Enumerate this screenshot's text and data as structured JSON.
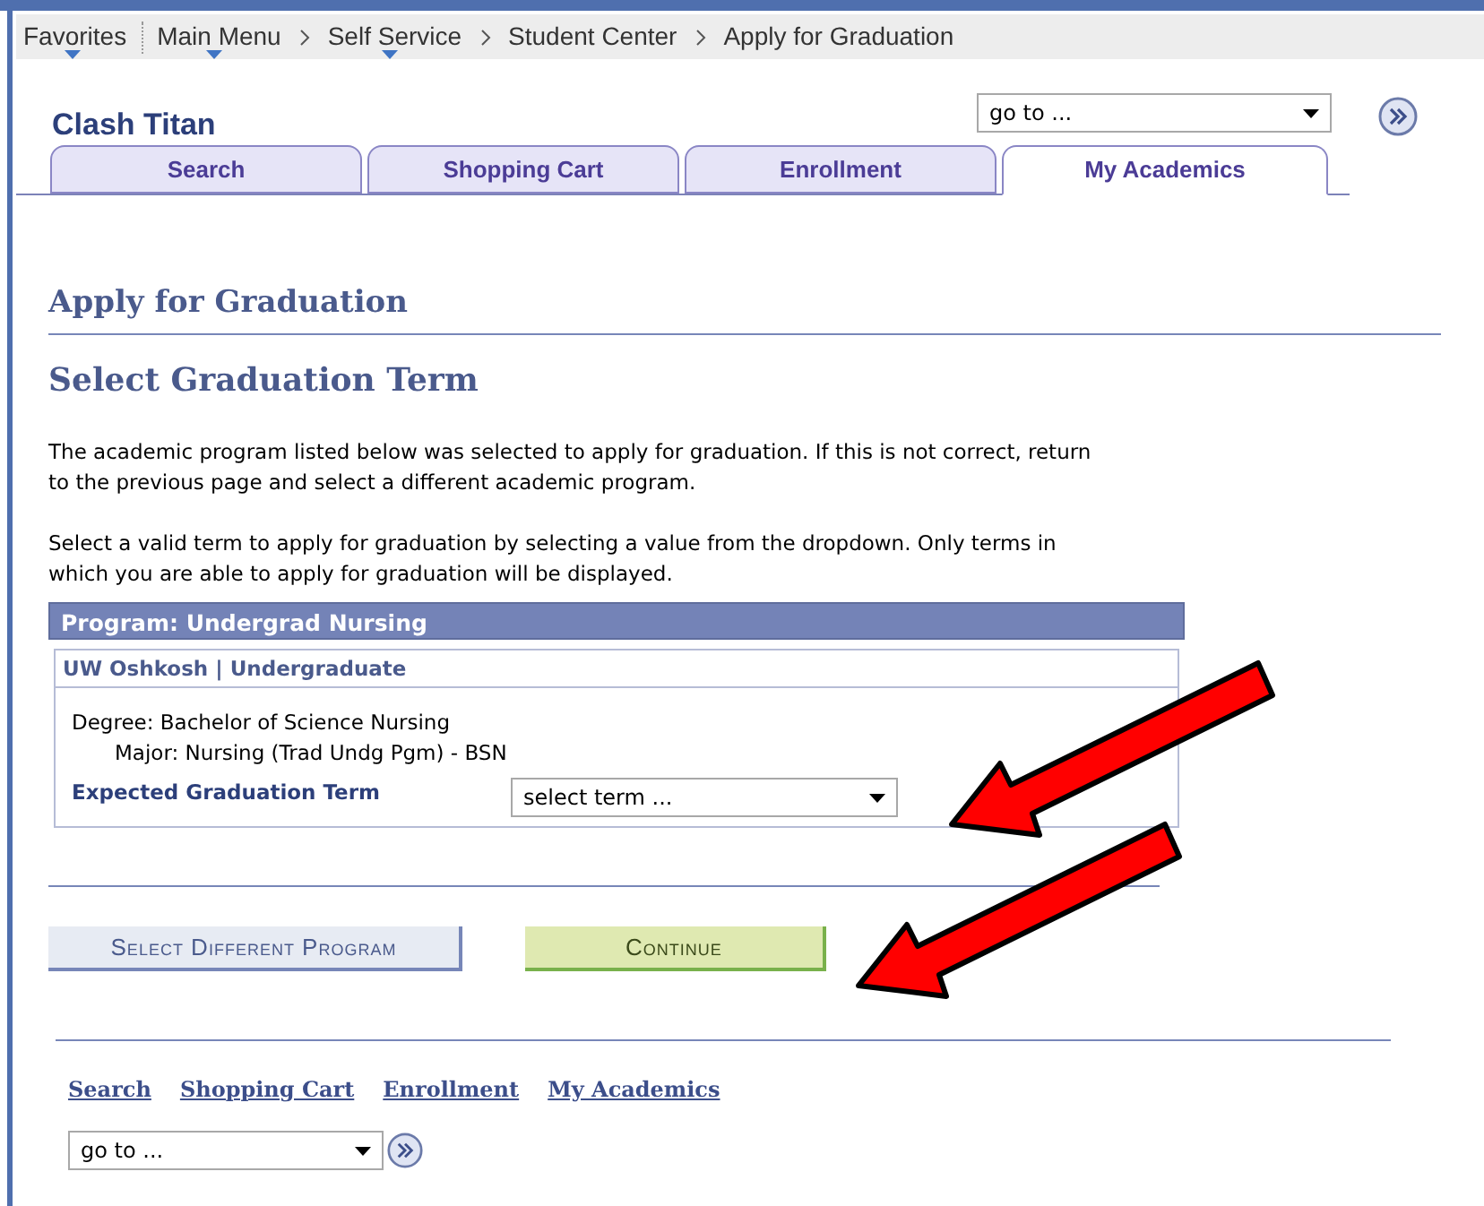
{
  "breadcrumbs": [
    {
      "label": "Favorites",
      "dropdown": true
    },
    {
      "label": "Main Menu",
      "dropdown": true
    },
    {
      "label": "Self Service",
      "dropdown": true
    },
    {
      "label": "Student Center",
      "dropdown": false
    },
    {
      "label": "Apply for Graduation",
      "dropdown": false
    }
  ],
  "student_name": "Clash Titan",
  "goto_select": {
    "value": "go to ..."
  },
  "tabs": [
    {
      "label": "Search",
      "selected": false
    },
    {
      "label": "Shopping Cart",
      "selected": false
    },
    {
      "label": "Enrollment",
      "selected": false
    },
    {
      "label": "My Academics",
      "selected": true
    }
  ],
  "page_title": "Apply for Graduation",
  "section_title": "Select Graduation Term",
  "instructions": [
    "The academic program listed below was selected to apply for graduation. If this is not correct, return to the previous page and select a different academic program.",
    "Select a valid term to apply for graduation by selecting a value from the dropdown. Only terms in which you are able to apply for graduation will be displayed."
  ],
  "program": {
    "header": "Program: Undergrad Nursing",
    "institution": "UW Oshkosh | Undergraduate",
    "degree": "Degree: Bachelor of Science Nursing",
    "major": "Major: Nursing (Trad Undg Pgm) - BSN",
    "term_label": "Expected Graduation Term",
    "term_select": {
      "value": "select term ..."
    }
  },
  "buttons": [
    {
      "label": "Select Different Program",
      "kind": "secondary"
    },
    {
      "label": "Continue",
      "kind": "primary"
    }
  ],
  "footer_links": [
    "Search",
    "Shopping Cart",
    "Enrollment",
    "My Academics"
  ],
  "footer_goto": {
    "value": "go to ..."
  }
}
